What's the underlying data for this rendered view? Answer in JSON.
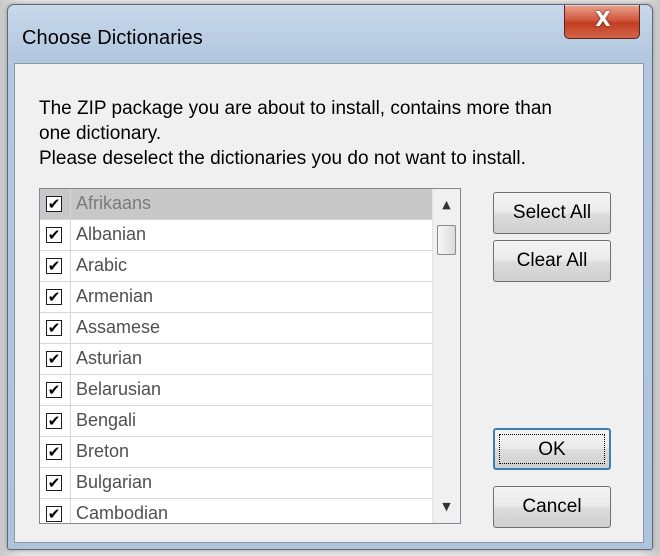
{
  "window": {
    "title": "Choose Dictionaries",
    "close_icon": "close-icon"
  },
  "message": {
    "line1": "The ZIP package you are about to install, contains more than",
    "line2": "one dictionary.",
    "line3": "Please deselect the dictionaries you do not want to install."
  },
  "dictionaries": [
    {
      "label": "Afrikaans",
      "checked": true,
      "selected": true
    },
    {
      "label": "Albanian",
      "checked": true
    },
    {
      "label": "Arabic",
      "checked": true
    },
    {
      "label": "Armenian",
      "checked": true
    },
    {
      "label": "Assamese",
      "checked": true
    },
    {
      "label": "Asturian",
      "checked": true
    },
    {
      "label": "Belarusian",
      "checked": true
    },
    {
      "label": "Bengali",
      "checked": true
    },
    {
      "label": "Breton",
      "checked": true
    },
    {
      "label": "Bulgarian",
      "checked": true
    },
    {
      "label": "Cambodian",
      "checked": true
    }
  ],
  "buttons": {
    "select_all": "Select All",
    "clear_all": "Clear All",
    "ok": "OK",
    "cancel": "Cancel"
  },
  "glyphs": {
    "check": "✔",
    "close": "X",
    "scroll_up": "▲",
    "scroll_down": "▼"
  },
  "colors": {
    "close_button": "#c9462b",
    "selected_row": "#c8c8c8"
  }
}
